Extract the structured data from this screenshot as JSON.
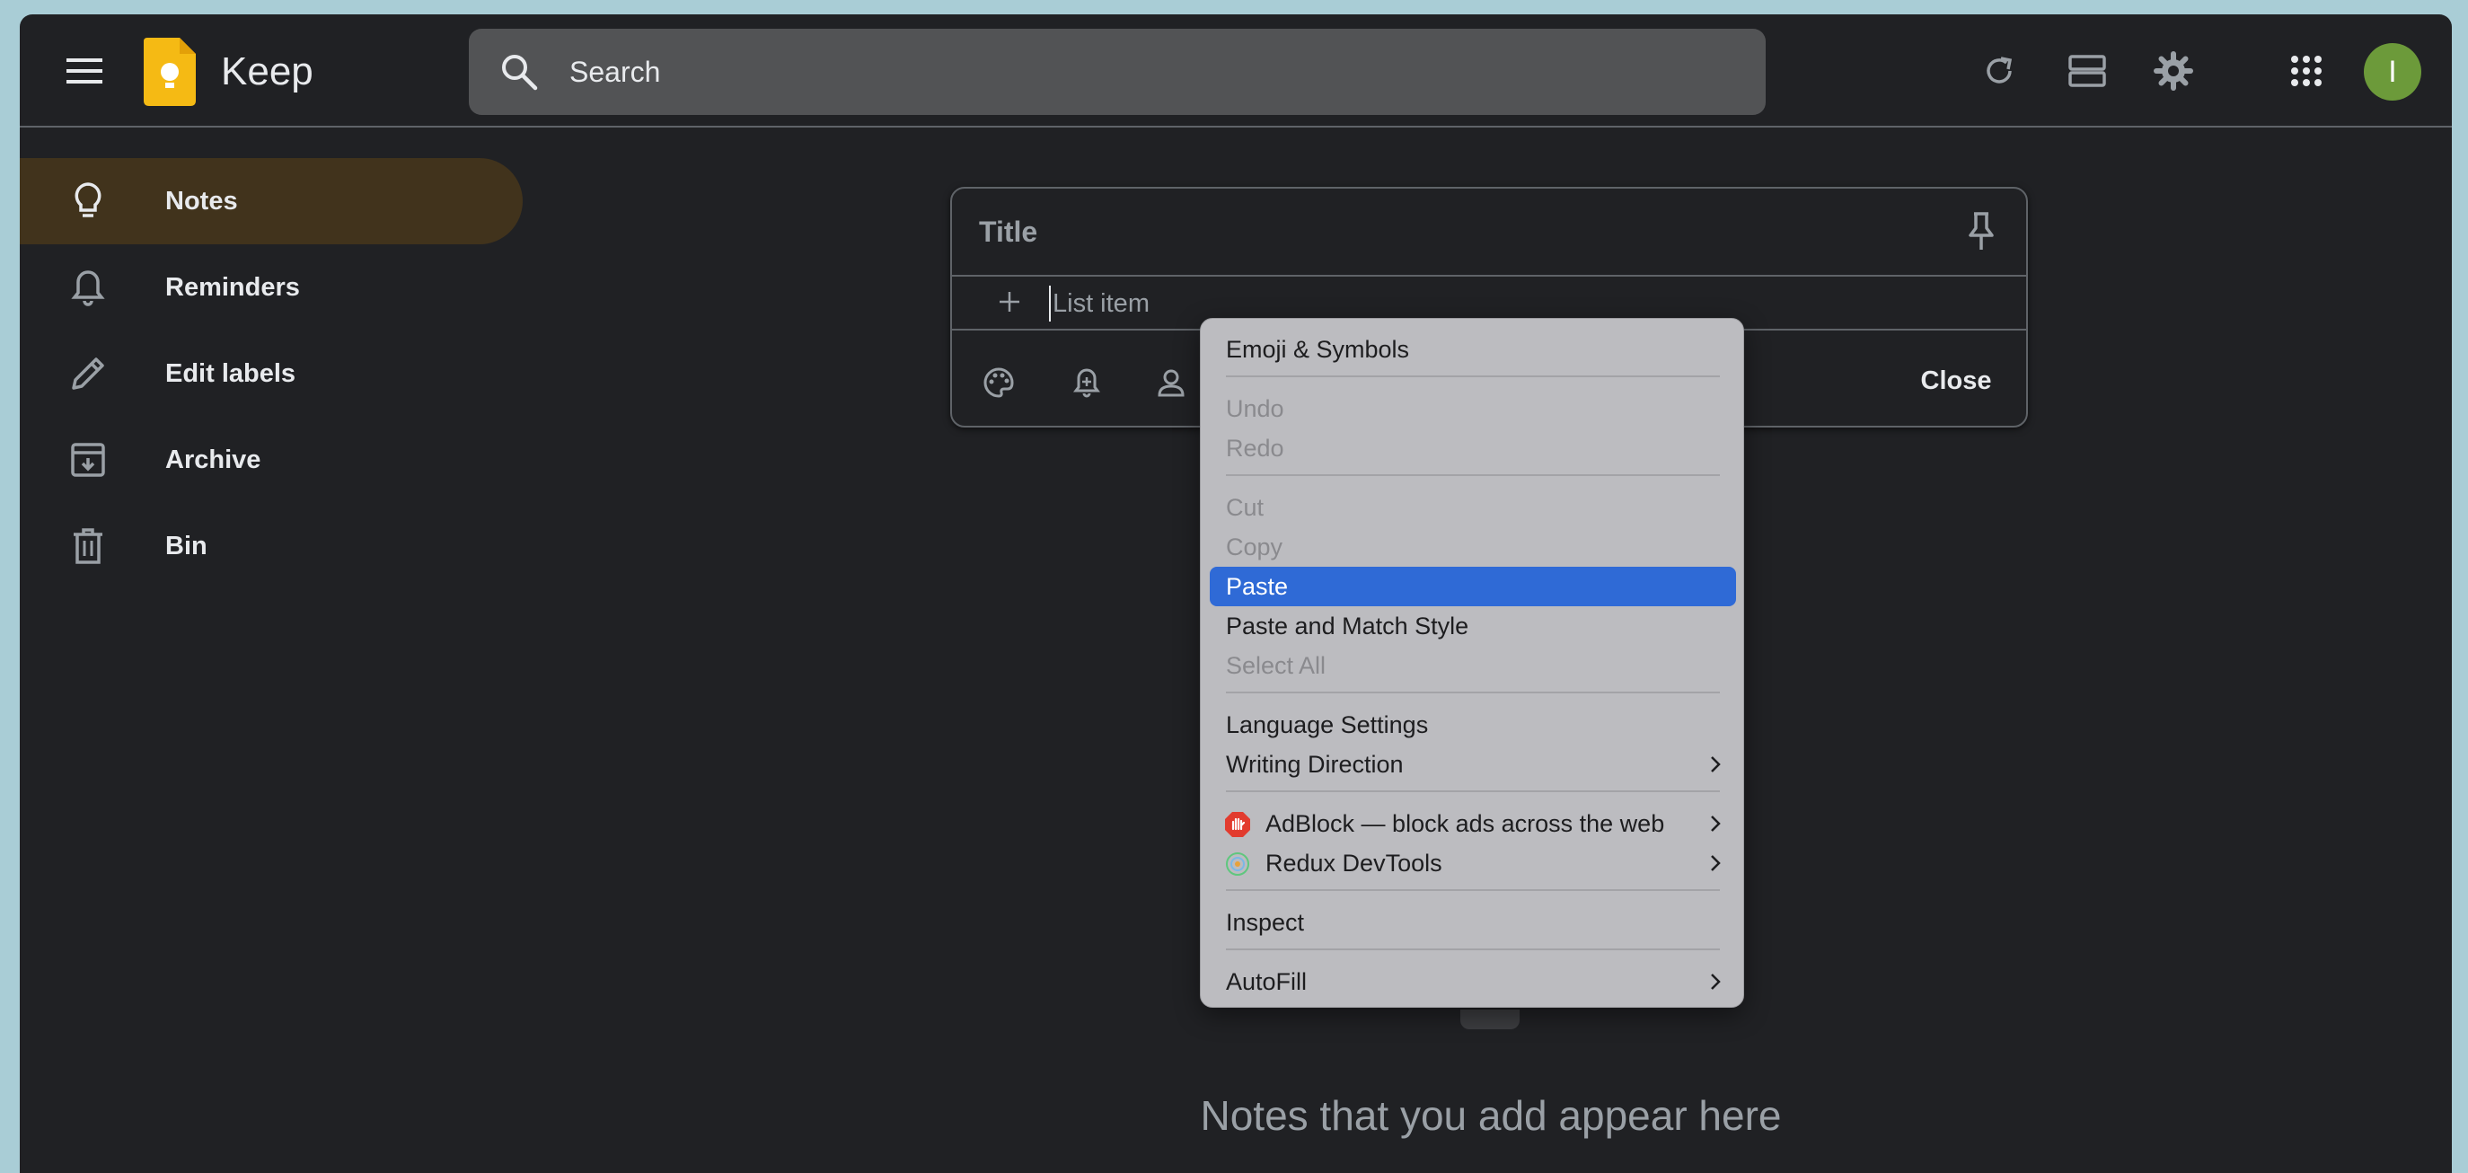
{
  "header": {
    "app_name": "Keep",
    "search_placeholder": "Search",
    "avatar_letter": "I"
  },
  "sidebar": {
    "items": [
      {
        "label": "Notes",
        "icon": "lightbulb-icon",
        "active": true
      },
      {
        "label": "Reminders",
        "icon": "bell-icon",
        "active": false
      },
      {
        "label": "Edit labels",
        "icon": "pencil-icon",
        "active": false
      },
      {
        "label": "Archive",
        "icon": "archive-icon",
        "active": false
      },
      {
        "label": "Bin",
        "icon": "trash-icon",
        "active": false
      }
    ]
  },
  "note": {
    "title_placeholder": "Title",
    "list_item_placeholder": "List item",
    "close_label": "Close"
  },
  "empty_state": {
    "text": "Notes that you add appear here"
  },
  "context_menu": {
    "emoji": "Emoji & Symbols",
    "undo": "Undo",
    "redo": "Redo",
    "cut": "Cut",
    "copy": "Copy",
    "paste": "Paste",
    "paste_match": "Paste and Match Style",
    "select_all": "Select All",
    "language": "Language Settings",
    "writing_direction": "Writing Direction",
    "adblock": "AdBlock — block ads across the web",
    "redux": "Redux DevTools",
    "inspect": "Inspect",
    "autofill": "AutoFill"
  },
  "colors": {
    "background": "#202124",
    "active_nav": "#41331c",
    "menu_bg": "#bcbcc0",
    "menu_selected": "#2f6ad6",
    "avatar": "#6c9a3a",
    "keep_yellow": "#f5ba14"
  }
}
